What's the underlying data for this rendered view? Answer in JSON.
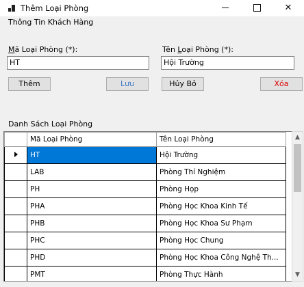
{
  "window": {
    "title": "Thêm Loại Phòng",
    "minimize_icon": "minimize-icon",
    "maximize_icon": "maximize-icon",
    "close_icon": "close-icon"
  },
  "form": {
    "group_title": "Thông Tin Khách Hàng",
    "ma_label_prefix": "",
    "ma_label_underline": "M",
    "ma_label_rest": "ã Loại Phòng (*):",
    "ma_value": "HT",
    "ten_label_prefix": "Tên ",
    "ten_label_underline": "L",
    "ten_label_rest": "oại Phòng (*):",
    "ten_value": "Hội Trường"
  },
  "buttons": {
    "them": "Thêm",
    "luu": "Lưu",
    "huy": "Hủy Bỏ",
    "xoa": "Xóa"
  },
  "list": {
    "title": "Danh Sách Loại Phòng",
    "columns": [
      "Mã Loại Phòng",
      "Tên Loại Phòng"
    ],
    "rows": [
      [
        "HT",
        "Hội Trường"
      ],
      [
        "LAB",
        "Phòng Thí Nghiệm"
      ],
      [
        "PH",
        "Phòng Họp"
      ],
      [
        "PHA",
        "Phòng Học Khoa Kinh Tế"
      ],
      [
        "PHB",
        "Phòng Học Khoa Sư Phạm"
      ],
      [
        "PHC",
        "Phòng Học Chung"
      ],
      [
        "PHD",
        "Phòng Học Khoa Công Nghệ Th..."
      ],
      [
        "PMT",
        "Phòng Thực Hành"
      ]
    ],
    "selected_row": 0
  },
  "colors": {
    "selection": "#0078d7",
    "disabled_text": "#3c78c8",
    "delete_text": "#dd0000"
  }
}
